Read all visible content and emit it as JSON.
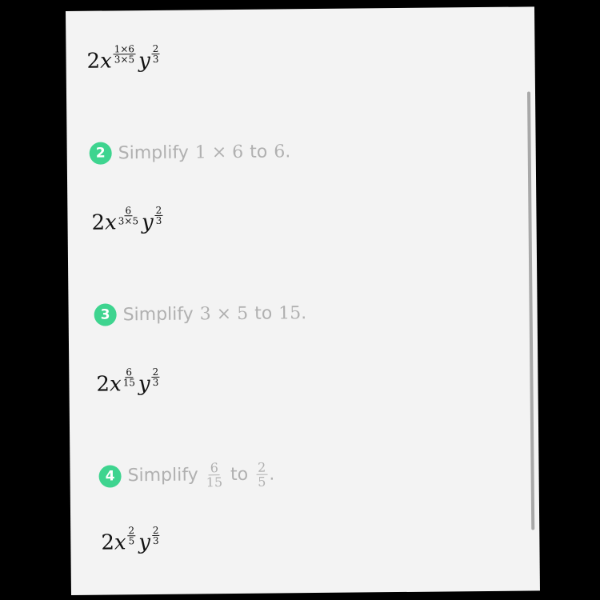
{
  "expressions": [
    {
      "coef": "2",
      "var1": "x",
      "exp1_num": "1×6",
      "exp1_den": "3×5",
      "var2": "y",
      "exp2_num": "2",
      "exp2_den": "3"
    },
    {
      "coef": "2",
      "var1": "x",
      "exp1_num": "6",
      "exp1_den": "3×5",
      "var2": "y",
      "exp2_num": "2",
      "exp2_den": "3"
    },
    {
      "coef": "2",
      "var1": "x",
      "exp1_num": "6",
      "exp1_den": "15",
      "var2": "y",
      "exp2_num": "2",
      "exp2_den": "3"
    },
    {
      "coef": "2",
      "var1": "x",
      "exp1_num": "2",
      "exp1_den": "5",
      "var2": "y",
      "exp2_num": "2",
      "exp2_den": "3"
    }
  ],
  "steps": [
    {
      "number": "2",
      "verb": "Simplify",
      "from": "1 × 6",
      "to_word": "to",
      "to": "6",
      "end": "."
    },
    {
      "number": "3",
      "verb": "Simplify",
      "from": "3 × 5",
      "to_word": "to",
      "to": "15",
      "end": "."
    },
    {
      "number": "4",
      "verb": "Simplify",
      "from_num": "6",
      "from_den": "15",
      "to_word": "to",
      "to_num": "2",
      "to_den": "5",
      "end": "."
    }
  ],
  "colors": {
    "badge": "#3ed48f",
    "step_text": "#b0b0b0",
    "panel": "#f3f3f3"
  }
}
